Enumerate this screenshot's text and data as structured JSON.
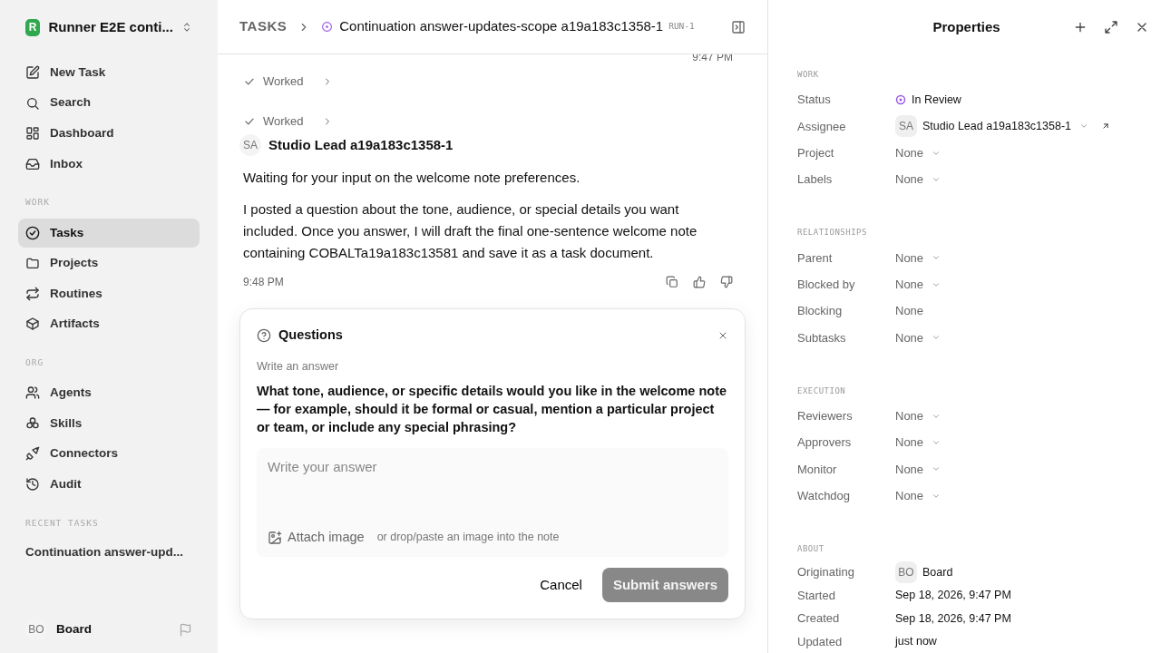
{
  "workspace": {
    "initial": "R",
    "name": "Runner E2E conti..."
  },
  "sidebar": {
    "top_items": [
      {
        "label": "New Task"
      },
      {
        "label": "Search"
      },
      {
        "label": "Dashboard"
      },
      {
        "label": "Inbox"
      }
    ],
    "sections": [
      {
        "title": "WORK",
        "items": [
          {
            "label": "Tasks",
            "selected": true
          },
          {
            "label": "Projects",
            "selected": false
          },
          {
            "label": "Routines",
            "selected": false
          },
          {
            "label": "Artifacts",
            "selected": false
          }
        ]
      },
      {
        "title": "ORG",
        "items": [
          {
            "label": "Agents",
            "selected": false
          },
          {
            "label": "Skills",
            "selected": false
          },
          {
            "label": "Connectors",
            "selected": false
          },
          {
            "label": "Audit",
            "selected": false
          }
        ]
      }
    ],
    "recent_title": "RECENT TASKS",
    "recent": [
      "Continuation answer-upd..."
    ],
    "user": {
      "initials": "BO",
      "name": "Board"
    }
  },
  "header": {
    "crumb": "TASKS",
    "title": "Continuation answer-updates-scope a19a183c1358-1",
    "run": "RUN-1"
  },
  "thread": {
    "prev_time": "9:47 PM",
    "steps": [
      {
        "label": "Worked",
        "done": true
      },
      {
        "label": "Worked",
        "done": true
      }
    ],
    "message": {
      "initials": "SA",
      "author": "Studio Lead a19a183c1358-1",
      "paragraphs": [
        "Waiting for your input on the welcome note preferences.",
        "I posted a question about the tone, audience, or special details you want included. Once you answer, I will draft the final one-sentence welcome note containing COBALTa19a183c13581 and save it as a task document."
      ],
      "time": "9:48 PM"
    }
  },
  "questions": {
    "title": "Questions",
    "hint": "Write an answer",
    "question": "What tone, audience, or specific details would you like in the welcome note — for example, should it be formal or casual, mention a particular project or team, or include any special phrasing?",
    "placeholder": "Write your answer",
    "attach": "Attach image",
    "attach_hint": "or drop/paste an image into the note",
    "cancel": "Cancel",
    "submit": "Submit answers",
    "submit_disabled": true
  },
  "properties": {
    "title": "Properties",
    "sections": [
      {
        "title": "WORK",
        "rows": [
          {
            "label": "Status",
            "kind": "status",
            "value": "In Review",
            "color": "#9b59e6"
          },
          {
            "label": "Assignee",
            "kind": "person_select",
            "initials": "SA",
            "value": "Studio Lead a19a183c1358-1"
          },
          {
            "label": "Project",
            "kind": "select",
            "value": "None"
          },
          {
            "label": "Labels",
            "kind": "select",
            "value": "None"
          }
        ]
      },
      {
        "title": "RELATIONSHIPS",
        "rows": [
          {
            "label": "Parent",
            "kind": "select",
            "value": "None"
          },
          {
            "label": "Blocked by",
            "kind": "select",
            "value": "None"
          },
          {
            "label": "Blocking",
            "kind": "text",
            "value": "None"
          },
          {
            "label": "Subtasks",
            "kind": "select",
            "value": "None"
          }
        ]
      },
      {
        "title": "EXECUTION",
        "rows": [
          {
            "label": "Reviewers",
            "kind": "select",
            "value": "None"
          },
          {
            "label": "Approvers",
            "kind": "select",
            "value": "None"
          },
          {
            "label": "Monitor",
            "kind": "select",
            "value": "None"
          },
          {
            "label": "Watchdog",
            "kind": "select",
            "value": "None"
          }
        ]
      },
      {
        "title": "ABOUT",
        "rows": [
          {
            "label": "Originating",
            "kind": "person",
            "initials": "BO",
            "value": "Board"
          },
          {
            "label": "Started",
            "kind": "date",
            "value": "Sep 18, 2026, 9:47 PM"
          },
          {
            "label": "Created",
            "kind": "date",
            "value": "Sep 18, 2026, 9:47 PM"
          },
          {
            "label": "Updated",
            "kind": "date",
            "value": "just now"
          }
        ]
      }
    ]
  }
}
